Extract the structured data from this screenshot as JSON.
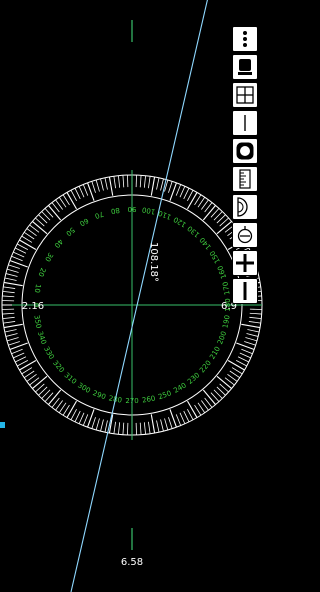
{
  "colors": {
    "background": "#000000",
    "dial": "#ffffff",
    "dial_labels": "#3fd03f",
    "crosshair": "#39c06a",
    "ray": "#8fd8ff",
    "text": "#ffffff",
    "edge_marker": "#23b6e8"
  },
  "protractor": {
    "center_reading": "108.18°",
    "left_reading": "2.16",
    "right_reading": "6.9",
    "bottom_reading": "6.58",
    "ray_angle_deg": 108.18,
    "degree_labels": [
      "0",
      "10",
      "20",
      "30",
      "40",
      "50",
      "60",
      "70",
      "80",
      "90",
      "100",
      "110",
      "120",
      "130",
      "140",
      "150",
      "160",
      "170",
      "180",
      "190",
      "200",
      "210",
      "220",
      "230",
      "240",
      "250",
      "260",
      "270",
      "280",
      "290",
      "300",
      "310",
      "320",
      "330",
      "340",
      "350"
    ]
  },
  "toolbar": {
    "buttons": [
      {
        "name": "more-options-icon"
      },
      {
        "name": "camera-icon"
      },
      {
        "name": "grid-icon"
      },
      {
        "name": "line-icon"
      },
      {
        "name": "circle-tool-icon"
      },
      {
        "name": "ruler-icon"
      },
      {
        "name": "protractor-icon"
      },
      {
        "name": "level-icon"
      },
      {
        "name": "plus-icon"
      },
      {
        "name": "minus-icon"
      }
    ]
  }
}
